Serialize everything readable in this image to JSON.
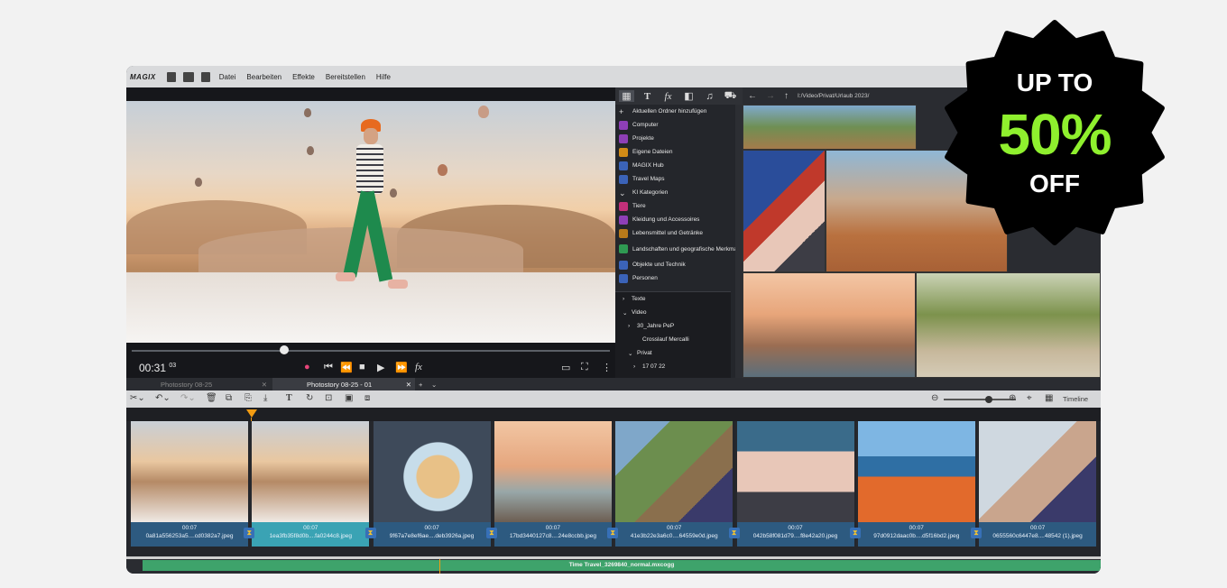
{
  "app": {
    "logo": "MAGIX"
  },
  "menu": [
    "Datei",
    "Bearbeiten",
    "Effekte",
    "Bereitstellen",
    "Hilfe"
  ],
  "preview": {
    "timecode": "00:31",
    "frames": "03",
    "scrub_position": 0.32
  },
  "pool": {
    "items": [
      {
        "label": "Aktuellen Ordner hinzufügen",
        "icon": "plus-icon",
        "color": "#24262b"
      },
      {
        "label": "Computer",
        "icon": "computer-icon",
        "color": "#8e3fb6"
      },
      {
        "label": "Projekte",
        "icon": "projects-icon",
        "color": "#8e3fb6"
      },
      {
        "label": "Eigene Dateien",
        "icon": "folder-icon",
        "color": "#d18b16"
      },
      {
        "label": "MAGIX Hub",
        "icon": "cloud-icon",
        "color": "#3b63b8"
      },
      {
        "label": "Travel Maps",
        "icon": "map-pin-icon",
        "color": "#3b63b8"
      },
      {
        "label": "KI Kategorien",
        "icon": "chevron-down-icon",
        "color": "#24262b"
      },
      {
        "label": "Tiere",
        "icon": "animal-icon",
        "color": "#c2307a"
      },
      {
        "label": "Kleidung und Accessoires",
        "icon": "clothing-icon",
        "color": "#8e3fb6"
      },
      {
        "label": "Lebensmittel und Getränke",
        "icon": "food-icon",
        "color": "#b87a1a"
      },
      {
        "label": "Landschaften und geografische Merkmale",
        "icon": "landscape-icon",
        "color": "#2f9a52"
      },
      {
        "label": "Objekte und Technik",
        "icon": "objects-icon",
        "color": "#3b63b8"
      },
      {
        "label": "Personen",
        "icon": "people-icon",
        "color": "#3b63b8"
      }
    ],
    "tree": [
      {
        "label": "Texte",
        "indent": 8,
        "arrow": "›"
      },
      {
        "label": "Video",
        "indent": 8,
        "arrow": "⌄"
      },
      {
        "label": "30_Jahre PeP",
        "indent": 14,
        "arrow": "›"
      },
      {
        "label": "Crosslauf Mercalli",
        "indent": 20,
        "arrow": ""
      },
      {
        "label": "Privat",
        "indent": 14,
        "arrow": "⌄"
      },
      {
        "label": "17 07 22",
        "indent": 20,
        "arrow": "›"
      }
    ]
  },
  "gallery": {
    "path": "I:/Video/Privat/Urlaub 2023/"
  },
  "tabs": {
    "inactive": "Photostory 08-25",
    "active": "Photostory 08-25 - 01"
  },
  "toolbar": {
    "view_label": "Timeline"
  },
  "clips": [
    {
      "duration": "00:07",
      "name": "0a81a556253a5....cd0382a7.jpeg"
    },
    {
      "duration": "00:07",
      "name": "1ea3fb35f8d0b....fa0244c8.jpeg"
    },
    {
      "duration": "00:07",
      "name": "9f67a7e8ef6ae....deb3926a.jpeg"
    },
    {
      "duration": "00:07",
      "name": "17bd3440127c8....24e8ccbb.jpeg"
    },
    {
      "duration": "00:07",
      "name": "41e3b22e3a6c0....64559e0d.jpeg"
    },
    {
      "duration": "00:07",
      "name": "042b58f081d79....f8e42a20.jpeg"
    },
    {
      "duration": "00:07",
      "name": "97d0912daac0b....d5f16bd2.jpeg"
    },
    {
      "duration": "00:07",
      "name": "0655560c6447e8....48542 (1).jpeg"
    }
  ],
  "audio": {
    "track": "Time Travel_3269840_normal.mxcogg"
  },
  "badge": {
    "line1": "UP TO",
    "line2": "50%",
    "line3": "OFF",
    "bg": "#000000",
    "accent": "#8ff02e"
  }
}
